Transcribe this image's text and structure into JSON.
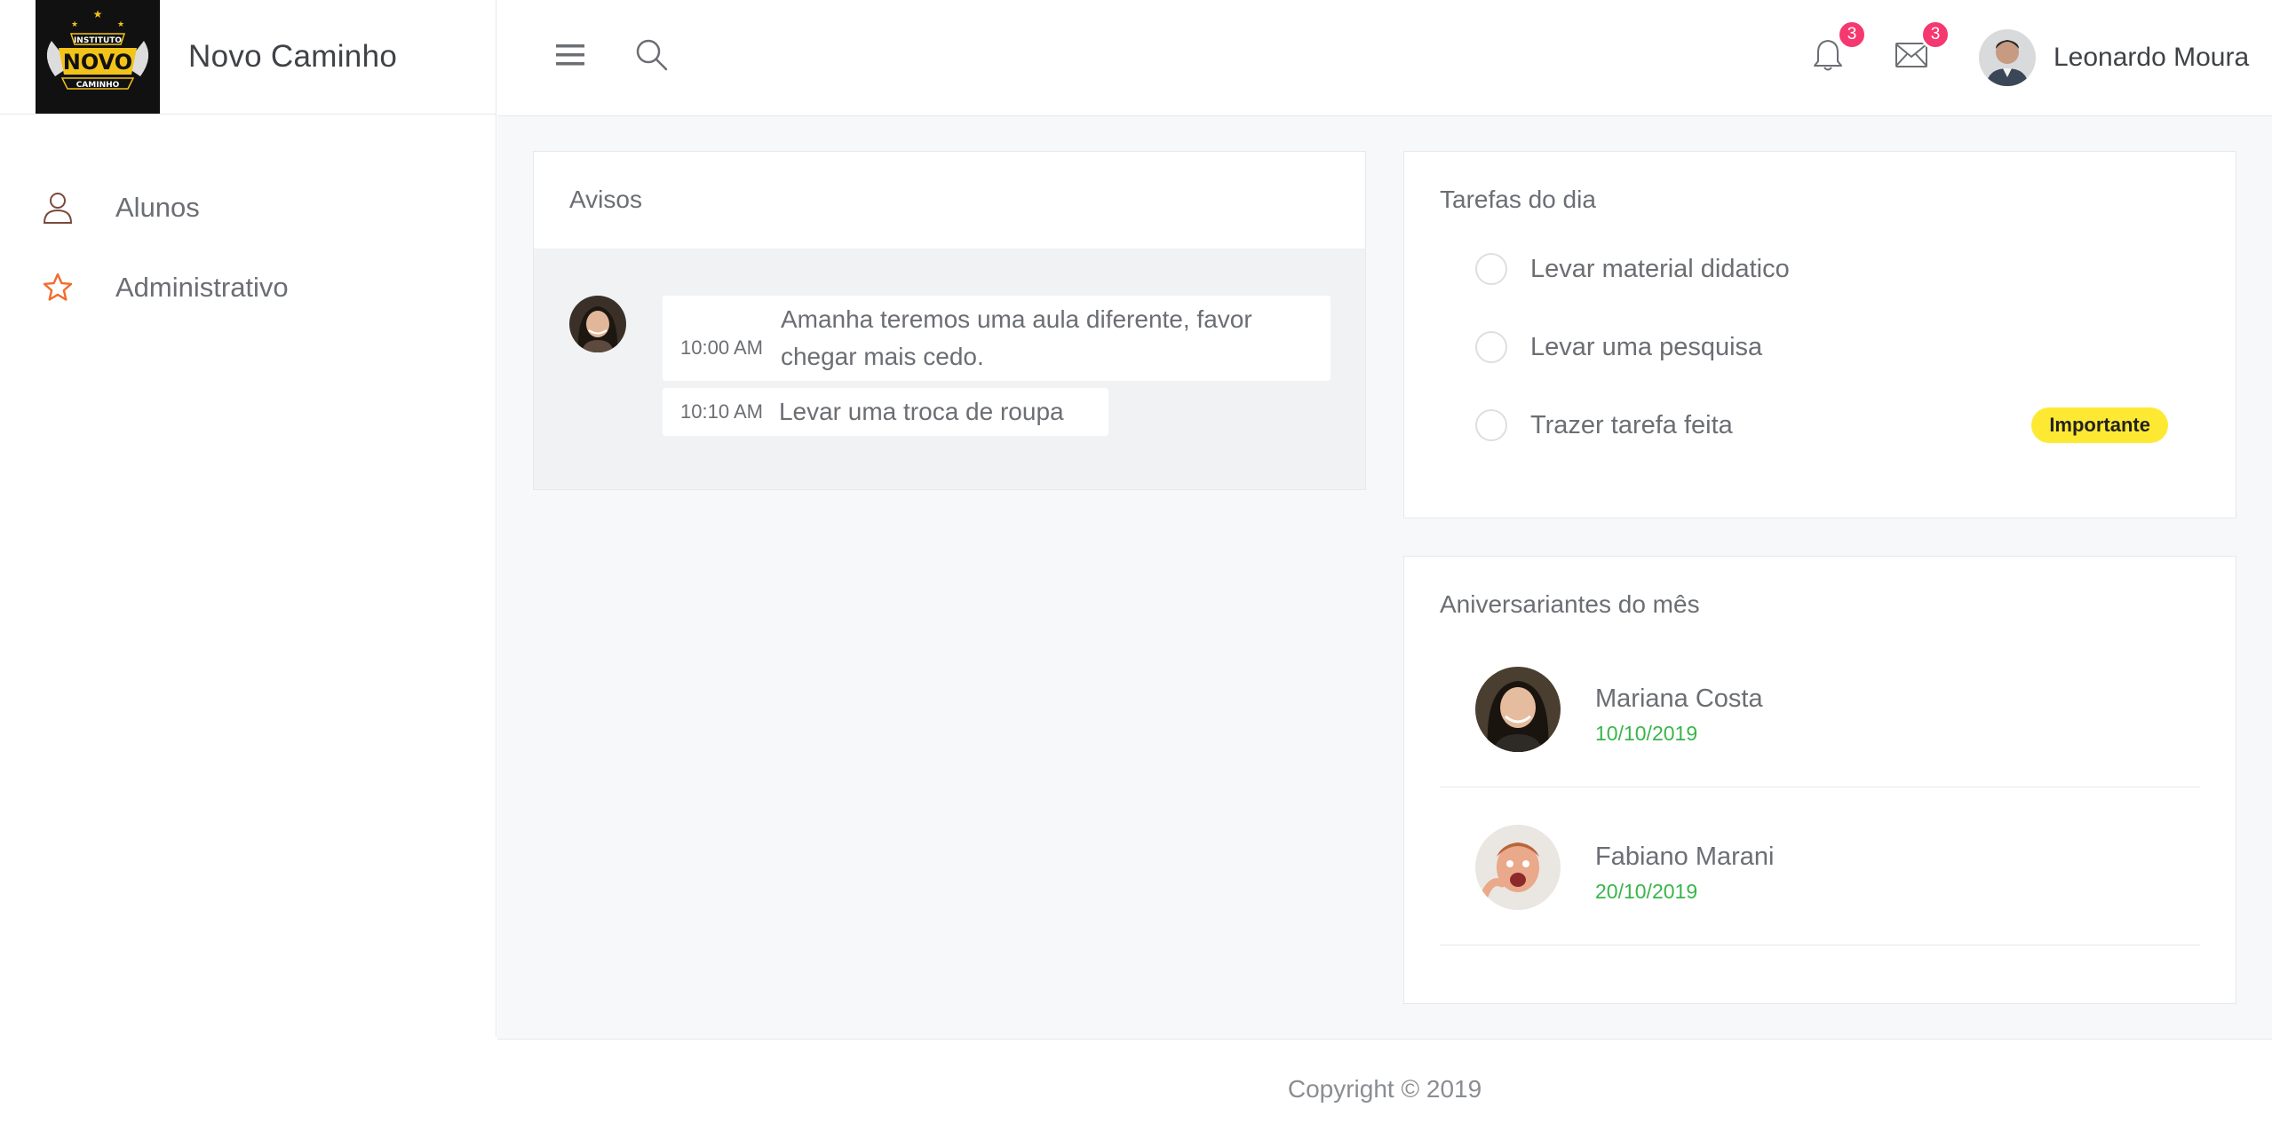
{
  "brand": {
    "name": "Novo Caminho",
    "logo_text_top": "INSTITUTO",
    "logo_text_main": "NOVO",
    "logo_text_bottom": "CAMINHO"
  },
  "sidebar": {
    "items": [
      {
        "label": "Alunos",
        "icon": "user-icon"
      },
      {
        "label": "Administrativo",
        "icon": "star-icon"
      }
    ]
  },
  "header": {
    "notifications_count": "3",
    "messages_count": "3",
    "user_name": "Leonardo Moura"
  },
  "avisos": {
    "title": "Avisos",
    "messages": [
      {
        "time": "10:00 AM",
        "text": "Amanha teremos uma aula diferente, favor chegar mais cedo."
      },
      {
        "time": "10:10 AM",
        "text": "Levar uma troca de roupa"
      }
    ]
  },
  "tarefas": {
    "title": "Tarefas do dia",
    "items": [
      {
        "label": "Levar material didatico"
      },
      {
        "label": "Levar uma pesquisa"
      },
      {
        "label": "Trazer tarefa feita",
        "tag": "Importante"
      }
    ]
  },
  "aniversariantes": {
    "title": "Aniversariantes do mês",
    "people": [
      {
        "name": "Mariana Costa",
        "date": "10/10/2019"
      },
      {
        "name": "Fabiano Marani",
        "date": "20/10/2019"
      }
    ]
  },
  "footer": {
    "copyright": "Copyright © 2019"
  },
  "colors": {
    "accent_badge": "#f5386f",
    "tag_yellow": "#fde932",
    "date_green": "#39b54a",
    "star_orange": "#f26b2e",
    "user_icon_brown": "#7a4a3a"
  }
}
